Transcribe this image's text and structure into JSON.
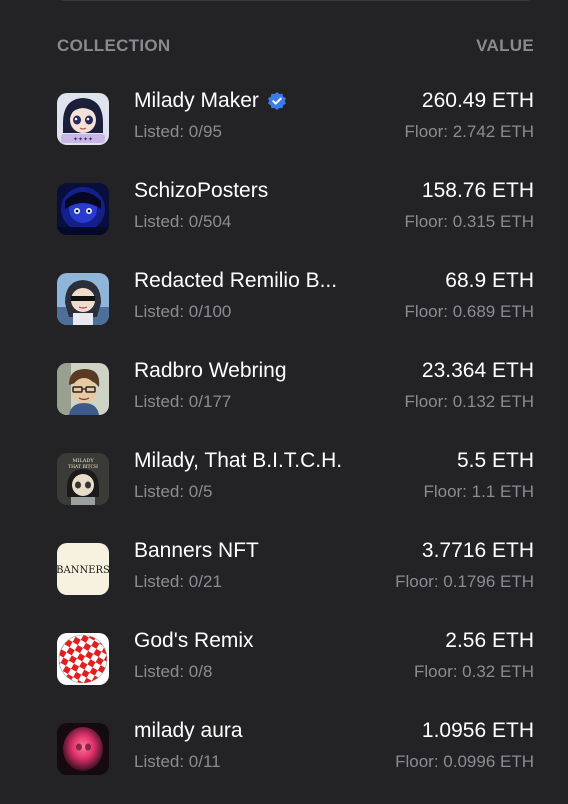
{
  "header": {
    "collection_label": "COLLECTION",
    "value_label": "VALUE"
  },
  "colors": {
    "background": "#232325",
    "muted_text": "#8c8c90",
    "verified_badge": "#3b7bea"
  },
  "collections": [
    {
      "name": "Milady Maker",
      "verified": true,
      "listed": "Listed: 0/95",
      "value": "260.49 ETH",
      "floor": "Floor: 2.742 ETH",
      "icon": "milady-maker-avatar-icon"
    },
    {
      "name": "SchizoPosters",
      "verified": false,
      "listed": "Listed: 0/504",
      "value": "158.76 ETH",
      "floor": "Floor: 0.315 ETH",
      "icon": "schizoposters-avatar-icon"
    },
    {
      "name": "Redacted Remilio B...",
      "verified": false,
      "listed": "Listed: 0/100",
      "value": "68.9 ETH",
      "floor": "Floor: 0.689 ETH",
      "icon": "redacted-remilio-avatar-icon"
    },
    {
      "name": "Radbro Webring",
      "verified": false,
      "listed": "Listed: 0/177",
      "value": "23.364 ETH",
      "floor": "Floor: 0.132 ETH",
      "icon": "radbro-avatar-icon"
    },
    {
      "name": "Milady, That B.I.T.C.H.",
      "verified": false,
      "listed": "Listed: 0/5",
      "value": "5.5 ETH",
      "floor": "Floor: 1.1 ETH",
      "icon": "milady-that-bitch-avatar-icon",
      "icon_text": "MILADY THAT BITCH"
    },
    {
      "name": "Banners NFT",
      "verified": false,
      "listed": "Listed: 0/21",
      "value": "3.7716 ETH",
      "floor": "Floor: 0.1796 ETH",
      "icon": "banners-logo-icon",
      "icon_text": "BANNERS"
    },
    {
      "name": "God's Remix",
      "verified": false,
      "listed": "Listed: 0/8",
      "value": "2.56 ETH",
      "floor": "Floor: 0.32 ETH",
      "icon": "checkered-ball-icon"
    },
    {
      "name": "milady aura",
      "verified": false,
      "listed": "Listed: 0/11",
      "value": "1.0956 ETH",
      "floor": "Floor: 0.0996 ETH",
      "icon": "milady-aura-avatar-icon"
    }
  ]
}
